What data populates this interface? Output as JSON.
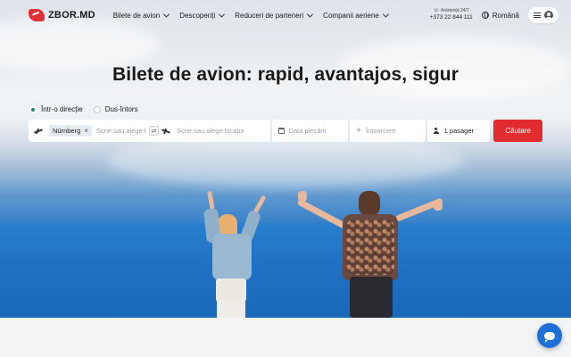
{
  "brand": {
    "name": "ZBOR.MD"
  },
  "nav": {
    "items": [
      {
        "label": "Bilete de avion"
      },
      {
        "label": "Descoperiți"
      },
      {
        "label": "Reduceri de parteneri"
      },
      {
        "label": "Companii aeriene"
      }
    ]
  },
  "support": {
    "label": "Asistență 24/7",
    "phone": "+373 22 844 111"
  },
  "language": {
    "label": "Română"
  },
  "hero": {
    "title": "Bilete de avion: rapid, avantajos, sigur"
  },
  "trip_type": {
    "options": [
      {
        "label": "Într-o direcție",
        "selected": true
      },
      {
        "label": "Dus-întors",
        "selected": false
      }
    ]
  },
  "search": {
    "origin_chip": "Nürnberg",
    "origin_placeholder": "Scrie sau alege locația",
    "destination_placeholder": "Scrie sau alege locația",
    "departure_placeholder": "Data plecării",
    "return_placeholder": "Întoarcere",
    "passengers": "1 pasager",
    "submit_label": "Căutare"
  },
  "colors": {
    "accent": "#e12b2f",
    "chat": "#1f6fd8",
    "radio": "#1a8a7a"
  }
}
